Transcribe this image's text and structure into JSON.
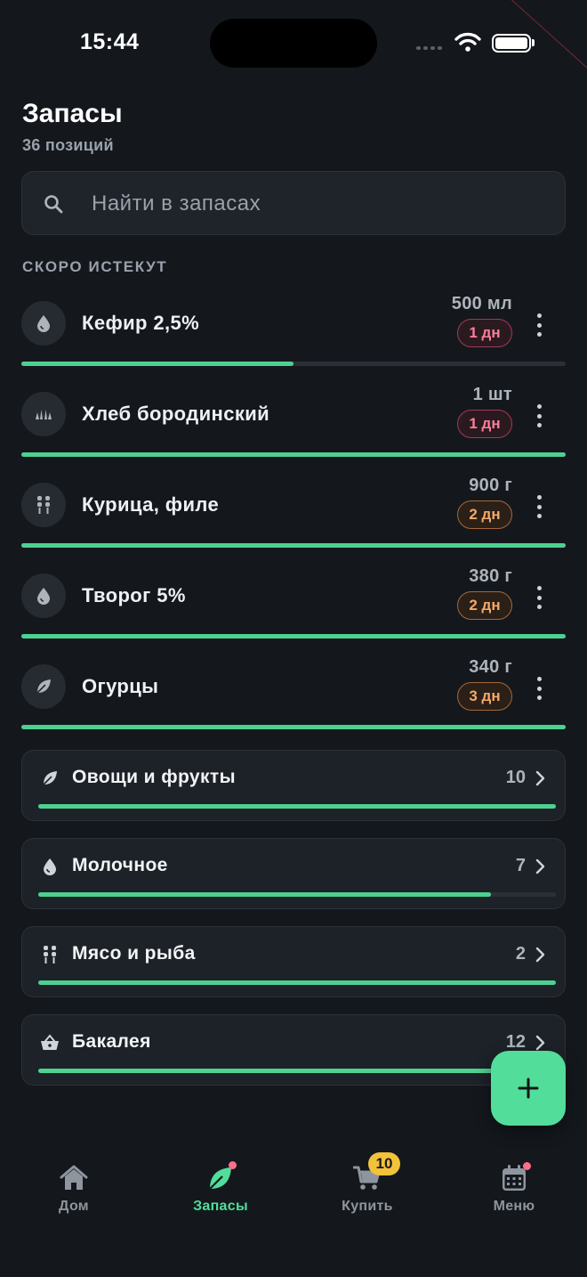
{
  "status_bar": {
    "time": "15:44"
  },
  "header": {
    "title": "Запасы",
    "subtitle": "36 позиций"
  },
  "search": {
    "placeholder": "Найти в запасах"
  },
  "expiring": {
    "section_label": "СКОРО ИСТЕКУТ",
    "items": [
      {
        "name": "Кефир 2,5%",
        "quantity": "500 мл",
        "days_left": "1 дн",
        "urgency": "red",
        "icon": "drop-icon",
        "freshness": 0.5
      },
      {
        "name": "Хлеб бородинский",
        "quantity": "1 шт",
        "days_left": "1 дн",
        "urgency": "red",
        "icon": "bread-icon",
        "freshness": 1.0
      },
      {
        "name": "Курица, филе",
        "quantity": "900 г",
        "days_left": "2 дн",
        "urgency": "orange",
        "icon": "meat-icon",
        "freshness": 1.0
      },
      {
        "name": "Творог 5%",
        "quantity": "380 г",
        "days_left": "2 дн",
        "urgency": "orange",
        "icon": "drop-icon",
        "freshness": 1.0
      },
      {
        "name": "Огурцы",
        "quantity": "340 г",
        "days_left": "3 дн",
        "urgency": "orange",
        "icon": "leaf-icon",
        "freshness": 1.0
      }
    ]
  },
  "categories": [
    {
      "name": "Овощи и фрукты",
      "count": "10",
      "icon": "leaf-icon",
      "fill": 1.0
    },
    {
      "name": "Молочное",
      "count": "7",
      "icon": "drop-icon",
      "fill": 0.875
    },
    {
      "name": "Мясо и рыба",
      "count": "2",
      "icon": "meat-icon",
      "fill": 1.0
    },
    {
      "name": "Бакалея",
      "count": "12",
      "icon": "basket-icon",
      "fill": 1.0
    }
  ],
  "bottom_nav": {
    "items": [
      {
        "label": "Дом",
        "icon": "home-icon",
        "active": false
      },
      {
        "label": "Запасы",
        "icon": "leaf-icon",
        "active": true
      },
      {
        "label": "Купить",
        "icon": "cart-icon",
        "active": false,
        "badge": "10"
      },
      {
        "label": "Меню",
        "icon": "calendar-icon",
        "active": false
      }
    ]
  },
  "colors": {
    "accent": "#52dd9b",
    "background": "#14181d",
    "urgent_red": "#ff7d9a",
    "warning_orange": "#f5a96a",
    "badge_yellow": "#f3c23a"
  }
}
